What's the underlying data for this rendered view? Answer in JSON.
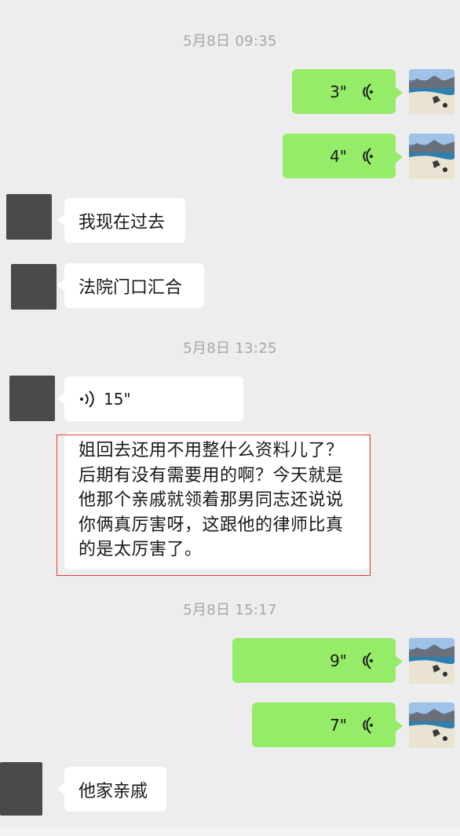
{
  "timestamps": [
    "5月8日 09:35",
    "5月8日 13:25",
    "5月8日 15:17"
  ],
  "messages": {
    "m1": {
      "duration": "3\""
    },
    "m2": {
      "duration": "4\""
    },
    "m3": {
      "text": "我现在过去"
    },
    "m4": {
      "text": "法院门口汇合"
    },
    "m5": {
      "duration": "15\""
    },
    "m6": {
      "text": "姐回去还用不用整什么资料儿了？后期有没有需要用的啊？今天就是他那个亲戚就领着那男同志还说说你俩真厉害呀，这跟他的律师比真的是太厉害了。"
    },
    "m7": {
      "duration": "9\""
    },
    "m8": {
      "duration": "7\""
    },
    "m9": {
      "text": "他家亲戚"
    }
  },
  "colors": {
    "self_bubble": "#95ec69",
    "other_bubble": "#ffffff",
    "background": "#ededed",
    "highlight": "#e03b3b"
  }
}
